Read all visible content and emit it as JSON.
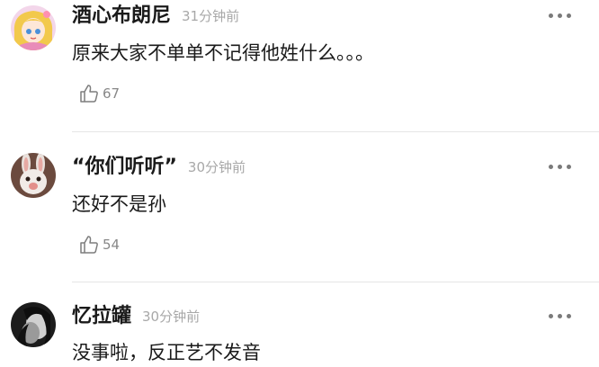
{
  "comments": [
    {
      "username": "酒心布朗尼",
      "time": "31分钟前",
      "text": "原来大家不单单不记得他姓什么。。。",
      "likes": "67",
      "avatar_icon": "anime-girl-avatar"
    },
    {
      "username": "“你们听听”",
      "time": "30分钟前",
      "text": "还好不是孙",
      "likes": "54",
      "avatar_icon": "rabbit-avatar"
    },
    {
      "username": "忆拉罐",
      "time": "30分钟前",
      "text": "没事啦，反正艺不发音",
      "likes": "",
      "avatar_icon": "bw-photo-avatar"
    }
  ],
  "colors": {
    "username": "#1a1a1a",
    "time": "#a8a8a8",
    "like_count": "#888888",
    "divider": "#e6e6e6",
    "more_dots": "#7a7a7a"
  }
}
